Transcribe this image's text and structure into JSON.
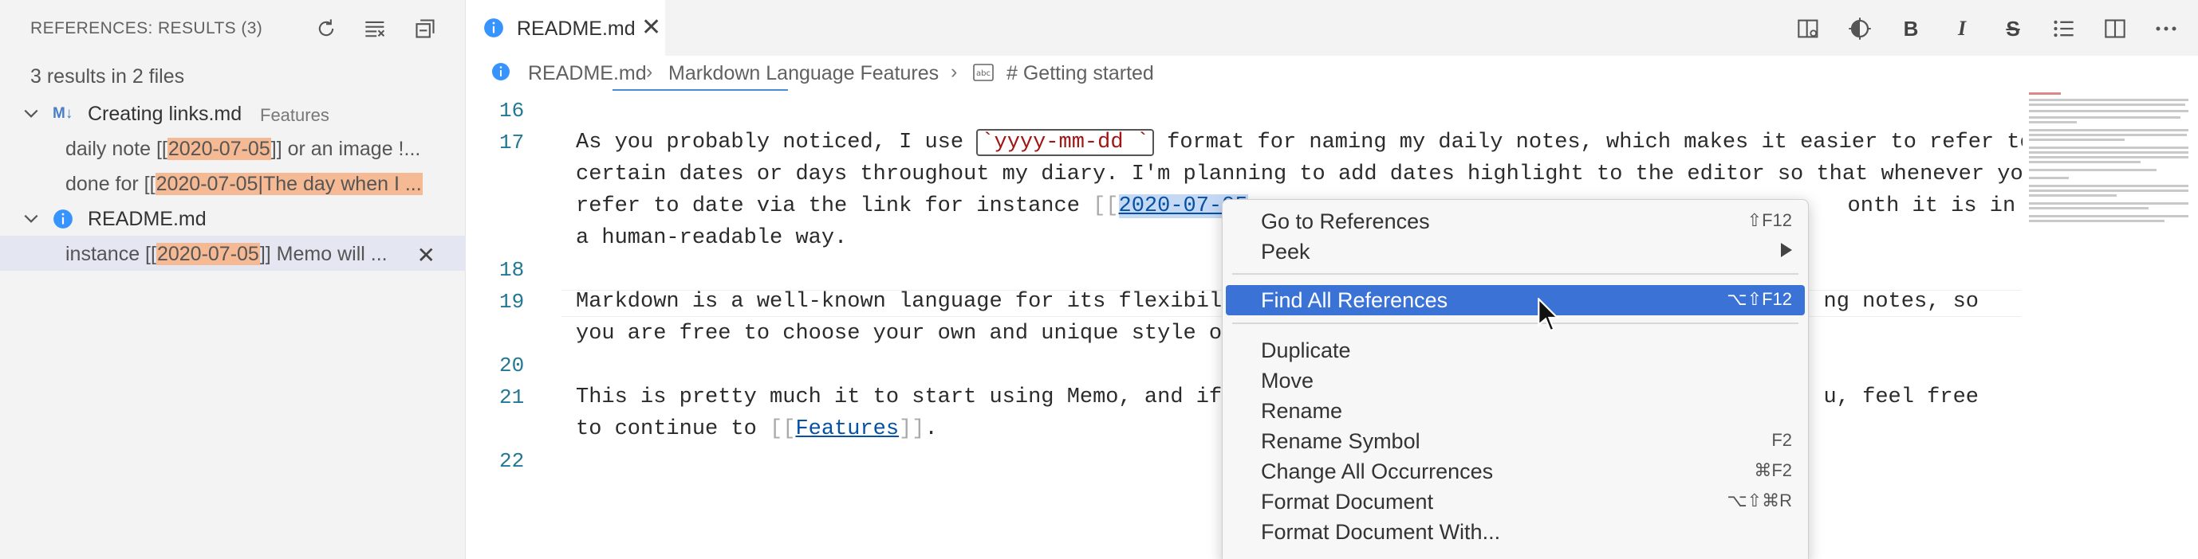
{
  "sidebar": {
    "title": "REFERENCES: RESULTS (3)",
    "summary": "3 results in 2 files",
    "actions": [
      "refresh-icon",
      "clear-results-icon",
      "collapse-all-icon"
    ],
    "files": [
      {
        "name": "Creating links.md",
        "description": "Features",
        "icon": "markdown-icon",
        "matches": [
          {
            "before": "daily note [[",
            "highlight": "2020-07-05",
            "after": "]] or an image !..."
          },
          {
            "before": "done for [[",
            "highlight": "2020-07-05|The day when I ...",
            "after": ""
          }
        ]
      },
      {
        "name": "README.md",
        "description": "",
        "icon": "info-icon",
        "matches": [
          {
            "before": "instance [[",
            "highlight": "2020-07-05",
            "after": "]] Memo will ..."
          }
        ]
      }
    ]
  },
  "tab": {
    "label": "README.md",
    "icon": "info-icon"
  },
  "toolbar": {
    "buttons": [
      "open-preview-icon",
      "theme-icon",
      "B",
      "I",
      "S",
      "list-icon",
      "split-editor-icon",
      "more-icon"
    ]
  },
  "breadcrumb": {
    "items": [
      "README.md",
      "Markdown Language Features",
      "# Getting started"
    ]
  },
  "code": {
    "line_numbers": [
      "16",
      "17",
      "18",
      "19",
      "20",
      "21",
      "22"
    ],
    "line17a_pre": "As you probably noticed, I use ",
    "line17a_code": "`yyyy-mm-dd `",
    "line17a_post": " format for naming my daily notes, which makes it easier to refer to",
    "line17b": "certain dates or days throughout my diary. I'm planning to add dates highlight to the editor so that whenever you",
    "line17c_pre": "refer to date via the link for instance ",
    "line17c_open": "[[",
    "line17c_ref": "2020-07-05",
    "line17c_post": "onth it is in",
    "line17d": "a human-readable way.",
    "line19a_pre": "Markdown is a well-known language for its flexibilit",
    "line19a_post": "ng notes, so",
    "line19b": "you are free to choose your own and unique style of",
    "line21a_pre": "This is pretty much it to start using Memo, and if y",
    "line21a_post": "u, feel free",
    "line21b_pre": "to continue to ",
    "line21b_open": "[[",
    "line21b_link": "Features",
    "line21b_close": "]]",
    "line21b_end": "."
  },
  "context_menu": {
    "items": [
      {
        "label": "Go to References",
        "shortcut": "⇧F12"
      },
      {
        "label": "Peek",
        "shortcut": ""
      },
      {
        "label": "Find All References",
        "shortcut": "⌥⇧F12"
      },
      {
        "label": "Duplicate",
        "shortcut": ""
      },
      {
        "label": "Move",
        "shortcut": ""
      },
      {
        "label": "Rename",
        "shortcut": ""
      },
      {
        "label": "Rename Symbol",
        "shortcut": "F2"
      },
      {
        "label": "Change All Occurrences",
        "shortcut": "⌘F2"
      },
      {
        "label": "Format Document",
        "shortcut": "⌥⇧⌘R"
      },
      {
        "label": "Format Document With...",
        "shortcut": ""
      }
    ],
    "active": "Find All References"
  },
  "colors": {
    "accent": "#3b72d6",
    "match_highlight": "#f5b994",
    "line_number": "#237893",
    "link": "#0451a5"
  }
}
